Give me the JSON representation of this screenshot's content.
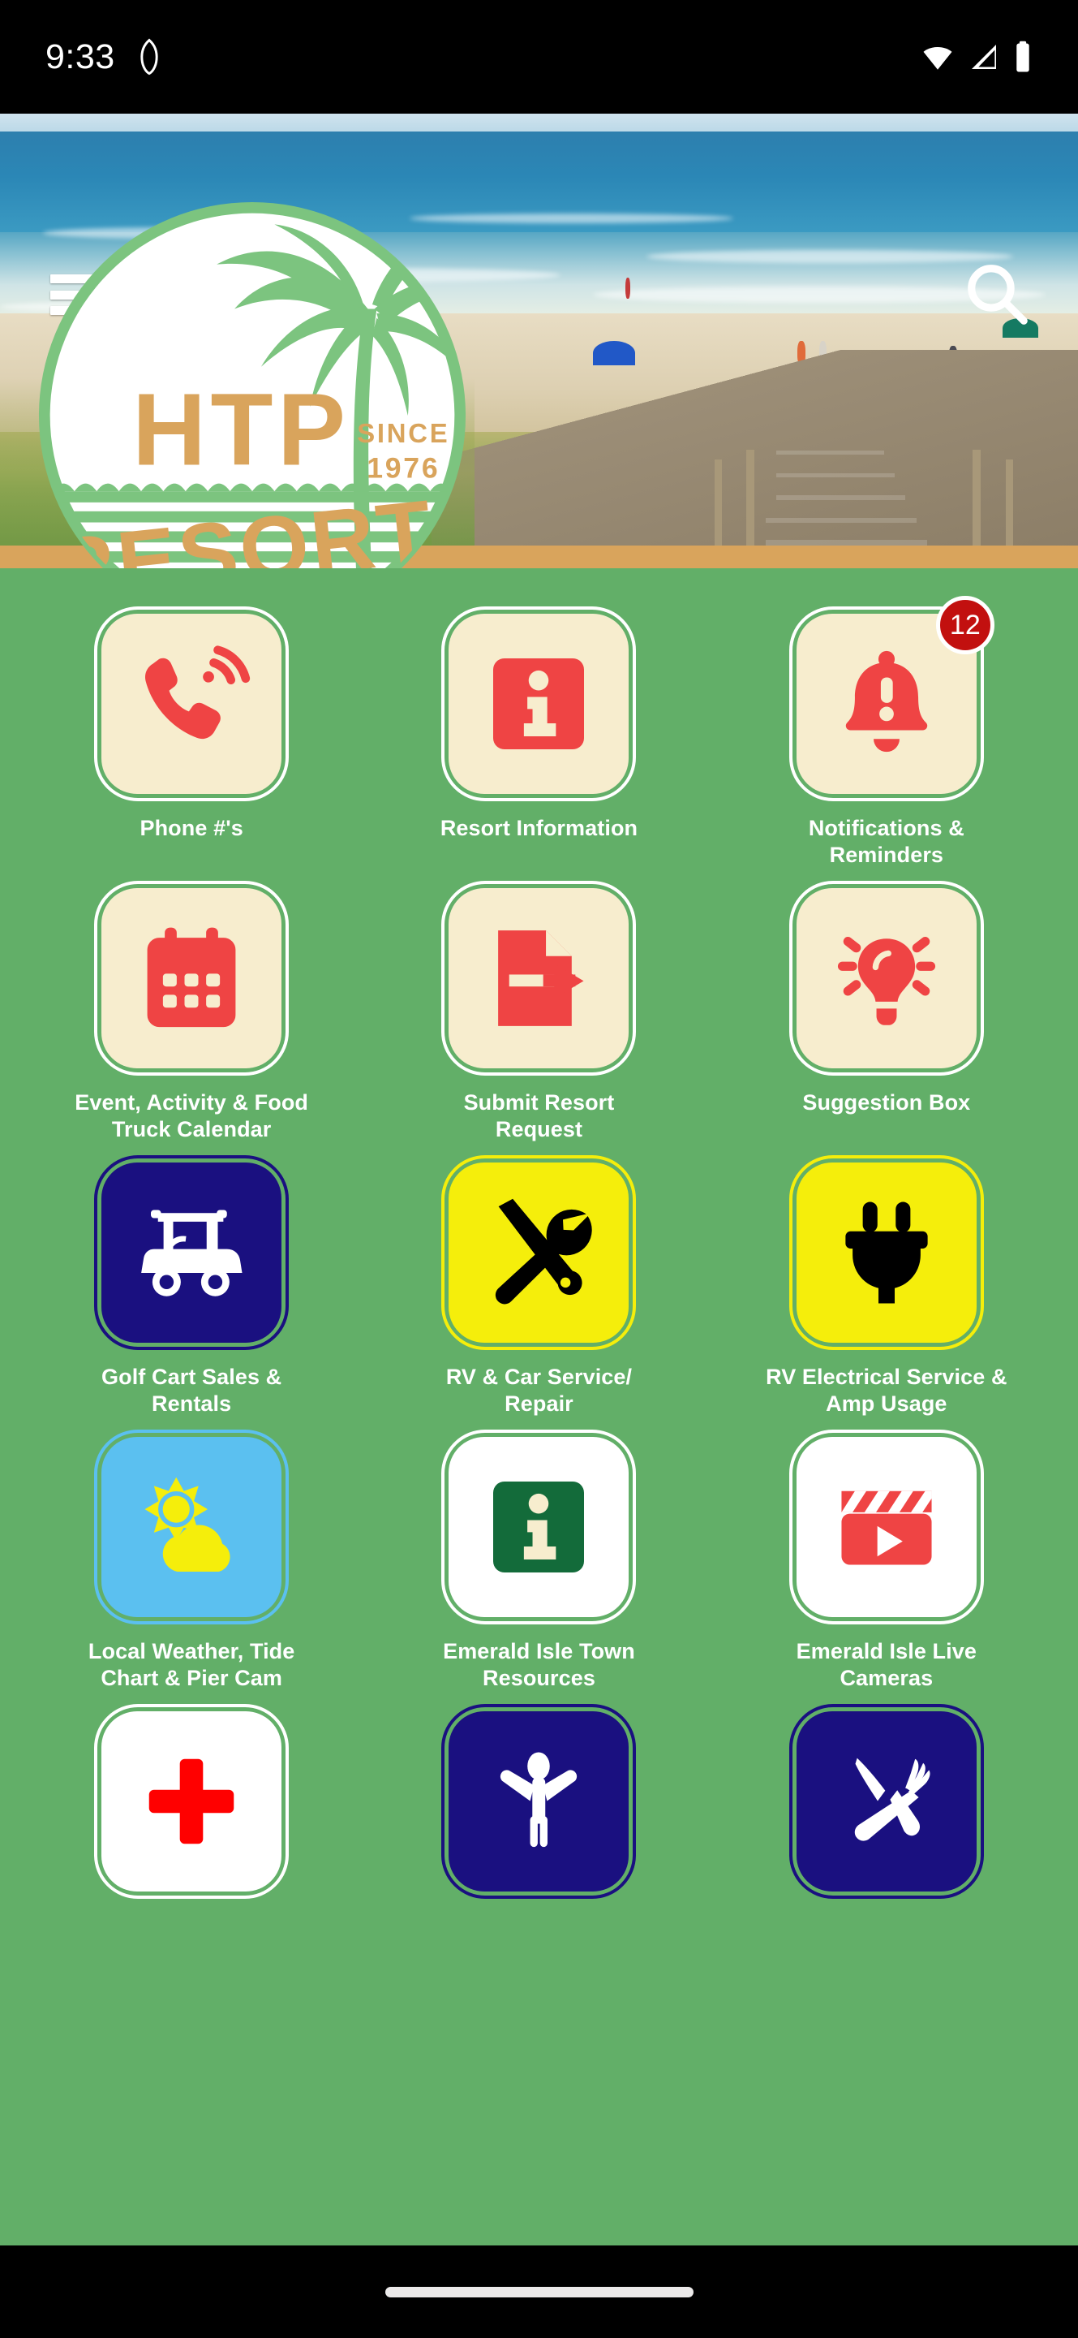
{
  "status_bar": {
    "time": "9:33",
    "icons": [
      "shield-icon",
      "wifi-icon",
      "cellular-signal-icon",
      "battery-icon"
    ]
  },
  "header": {
    "menu_icon": "hamburger-menu-icon",
    "search_icon": "search-icon",
    "logo": {
      "brand": "HTP",
      "word": "RESORT",
      "since_label": "SINCE",
      "since_year": "1976"
    }
  },
  "colors": {
    "page_background": "#62AF68",
    "tile_cream": "#F7EDCE",
    "icon_red": "#EF4444",
    "tile_navy": "#1A1080",
    "tile_yellow": "#F5EE0B",
    "tile_sky_blue": "#5BC0F0",
    "tile_white": "#FFFFFF",
    "badge_red": "#C2100F",
    "town_green": "#136B3A",
    "sand_band": "#D9A45C",
    "logo_tan": "#D9A45C",
    "logo_green": "#7CC47F"
  },
  "grid": {
    "tiles": [
      {
        "label": "Phone #'s",
        "icon": "phone-ringing-icon",
        "bg": "#F7EDCE",
        "ring": "#FFFFFF",
        "icon_color": "#EF4444",
        "badge": null
      },
      {
        "label": "Resort Information",
        "icon": "info-square-icon",
        "bg": "#F7EDCE",
        "ring": "#FFFFFF",
        "icon_color": "#EF4444",
        "badge": null
      },
      {
        "label": "Notifications & Reminders",
        "icon": "bell-alert-icon",
        "bg": "#F7EDCE",
        "ring": "#FFFFFF",
        "icon_color": "#EF4444",
        "badge": "12"
      },
      {
        "label": "Event, Activity & Food Truck Calendar",
        "icon": "calendar-icon",
        "bg": "#F7EDCE",
        "ring": "#FFFFFF",
        "icon_color": "#EF4444",
        "badge": null
      },
      {
        "label": "Submit Resort Request",
        "icon": "document-send-icon",
        "bg": "#F7EDCE",
        "ring": "#FFFFFF",
        "icon_color": "#EF4444",
        "badge": null
      },
      {
        "label": "Suggestion Box",
        "icon": "lightbulb-icon",
        "bg": "#F7EDCE",
        "ring": "#FFFFFF",
        "icon_color": "#EF4444",
        "badge": null
      },
      {
        "label": "Golf Cart Sales & Rentals",
        "icon": "golf-cart-icon",
        "bg": "#1A1080",
        "ring": "#1A1080",
        "icon_color": "#FFFFFF",
        "badge": null
      },
      {
        "label": "RV & Car Service/ Repair",
        "icon": "wrench-screwdriver-icon",
        "bg": "#F5EE0B",
        "ring": "#F5EE0B",
        "icon_color": "#000000",
        "badge": null
      },
      {
        "label": "RV Electrical Service & Amp Usage",
        "icon": "power-plug-icon",
        "bg": "#F5EE0B",
        "ring": "#F5EE0B",
        "icon_color": "#000000",
        "badge": null
      },
      {
        "label": "Local Weather, Tide Chart & Pier Cam",
        "icon": "sun-cloud-icon",
        "bg": "#5BC0F0",
        "ring": "#5BC0F0",
        "icon_color": "#F5EE0B",
        "badge": null
      },
      {
        "label": "Emerald Isle Town Resources",
        "icon": "info-square-icon",
        "bg": "#FFFFFF",
        "ring": "#FFFFFF",
        "icon_color": "#136B3A",
        "badge": null
      },
      {
        "label": "Emerald Isle Live Cameras",
        "icon": "clapperboard-play-icon",
        "bg": "#FFFFFF",
        "ring": "#FFFFFF",
        "icon_color": "#EF4444",
        "badge": null
      },
      {
        "label": "",
        "icon": "medical-cross-icon",
        "bg": "#FFFFFF",
        "ring": "#FFFFFF",
        "icon_color": "#FF0000",
        "badge": null
      },
      {
        "label": "",
        "icon": "person-arms-up-icon",
        "bg": "#1A1080",
        "ring": "#1A1080",
        "icon_color": "#FFFFFF",
        "badge": null
      },
      {
        "label": "",
        "icon": "fork-knife-icon",
        "bg": "#1A1080",
        "ring": "#1A1080",
        "icon_color": "#FFFFFF",
        "badge": null
      }
    ]
  },
  "navigation_bar": {
    "gesture_pill": "home-gesture-pill"
  }
}
